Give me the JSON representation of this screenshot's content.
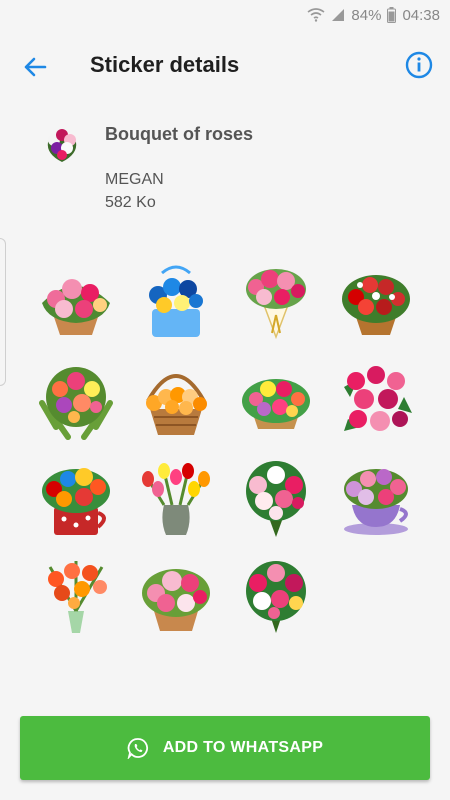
{
  "status_bar": {
    "battery": "84%",
    "time": "04:38",
    "icons": [
      "wifi-icon",
      "signal-icon",
      "battery-icon"
    ]
  },
  "app_bar": {
    "title": "Sticker details",
    "icons": [
      "back-arrow-icon",
      "info-icon"
    ]
  },
  "pack": {
    "name": "Bouquet of roses",
    "author": "MEGAN",
    "size": "582 Ko"
  },
  "stickers": [
    {
      "icon": "pink-roses-basket-icon"
    },
    {
      "icon": "blue-flowers-basket-icon"
    },
    {
      "icon": "roses-balloons-bouquet-icon"
    },
    {
      "icon": "red-roses-basket-icon"
    },
    {
      "icon": "mixed-bouquet-icon"
    },
    {
      "icon": "orange-roses-basket-icon"
    },
    {
      "icon": "colorful-flower-basket-icon"
    },
    {
      "icon": "pink-red-roses-cluster-icon"
    },
    {
      "icon": "roses-mug-icon"
    },
    {
      "icon": "tulips-vase-icon"
    },
    {
      "icon": "pink-white-roses-bouquet-icon"
    },
    {
      "icon": "flowers-teacup-icon"
    },
    {
      "icon": "orange-flowers-vase-icon"
    },
    {
      "icon": "pink-roses-basket-2-icon"
    },
    {
      "icon": "pink-roses-bouquet-icon"
    }
  ],
  "add_button": {
    "label": "ADD TO WHATSAPP",
    "icon": "whatsapp-icon"
  },
  "colors": {
    "accent": "#1e88e5",
    "button": "#4cbb3f",
    "background": "#f5f5f5"
  }
}
